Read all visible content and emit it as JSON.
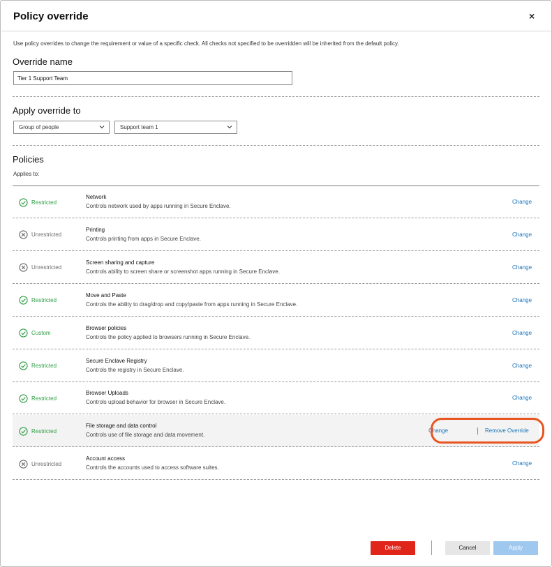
{
  "dialog": {
    "title": "Policy override",
    "close_glyph": "×",
    "description": "Use policy overrides to change the requirement or value of a specific check. All checks not specified to be overridden will be inherited from the default policy."
  },
  "override_name": {
    "label": "Override name",
    "value": "Tier 1 Support Team"
  },
  "apply_override": {
    "label": "Apply override to",
    "type_value": "Group of people",
    "group_value": "Support team 1"
  },
  "policies": {
    "label": "Policies",
    "applies_to": "Applies to:",
    "rows": [
      {
        "status": "Restricted",
        "kind": "check",
        "name": "Network",
        "description": "Controls network used by apps running in Secure Enclave.",
        "change": "Change"
      },
      {
        "status": "Unrestricted",
        "kind": "x",
        "name": "Printing",
        "description": "Controls printing from apps in Secure Enclave.",
        "change": "Change"
      },
      {
        "status": "Unrestricted",
        "kind": "x",
        "name": "Screen sharing and capture",
        "description": "Controls ability to screen share or screenshot apps running in Secure Enclave.",
        "change": "Change"
      },
      {
        "status": "Restricted",
        "kind": "check",
        "name": "Move and Paste",
        "description": "Controls the ability to drag/drop and copy/paste from apps running in Secure Enclave.",
        "change": "Change"
      },
      {
        "status": "Custom",
        "kind": "check",
        "name": "Browser policies",
        "description": "Controls the policy applied to browsers running in Secure Enclave.",
        "change": "Change"
      },
      {
        "status": "Restricted",
        "kind": "check",
        "name": "Secure Enclave Registry",
        "description": "Controls the registry in Secure Enclave.",
        "change": "Change"
      },
      {
        "status": "Restricted",
        "kind": "check",
        "name": "Browser Uploads",
        "description": "Controls upload behavior for browser in Secure Enclave.",
        "change": "Change"
      },
      {
        "status": "Restricted",
        "kind": "check",
        "name": "File storage and data control",
        "description": "Controls use of file storage and data movement.",
        "change": "Change",
        "remove": "Remove Override",
        "highlight": true
      },
      {
        "status": "Unrestricted",
        "kind": "x",
        "name": "Account access",
        "description": "Controls the accounts used to access software suites.",
        "change": "Change"
      }
    ]
  },
  "footer": {
    "delete": "Delete",
    "cancel": "Cancel",
    "apply": "Apply"
  },
  "colors": {
    "accent_link": "#1a73b8",
    "restricted_green": "#2e9e43",
    "delete_red": "#e0251b",
    "apply_disabled": "#9fc8ef",
    "annotation": "#e85520"
  }
}
